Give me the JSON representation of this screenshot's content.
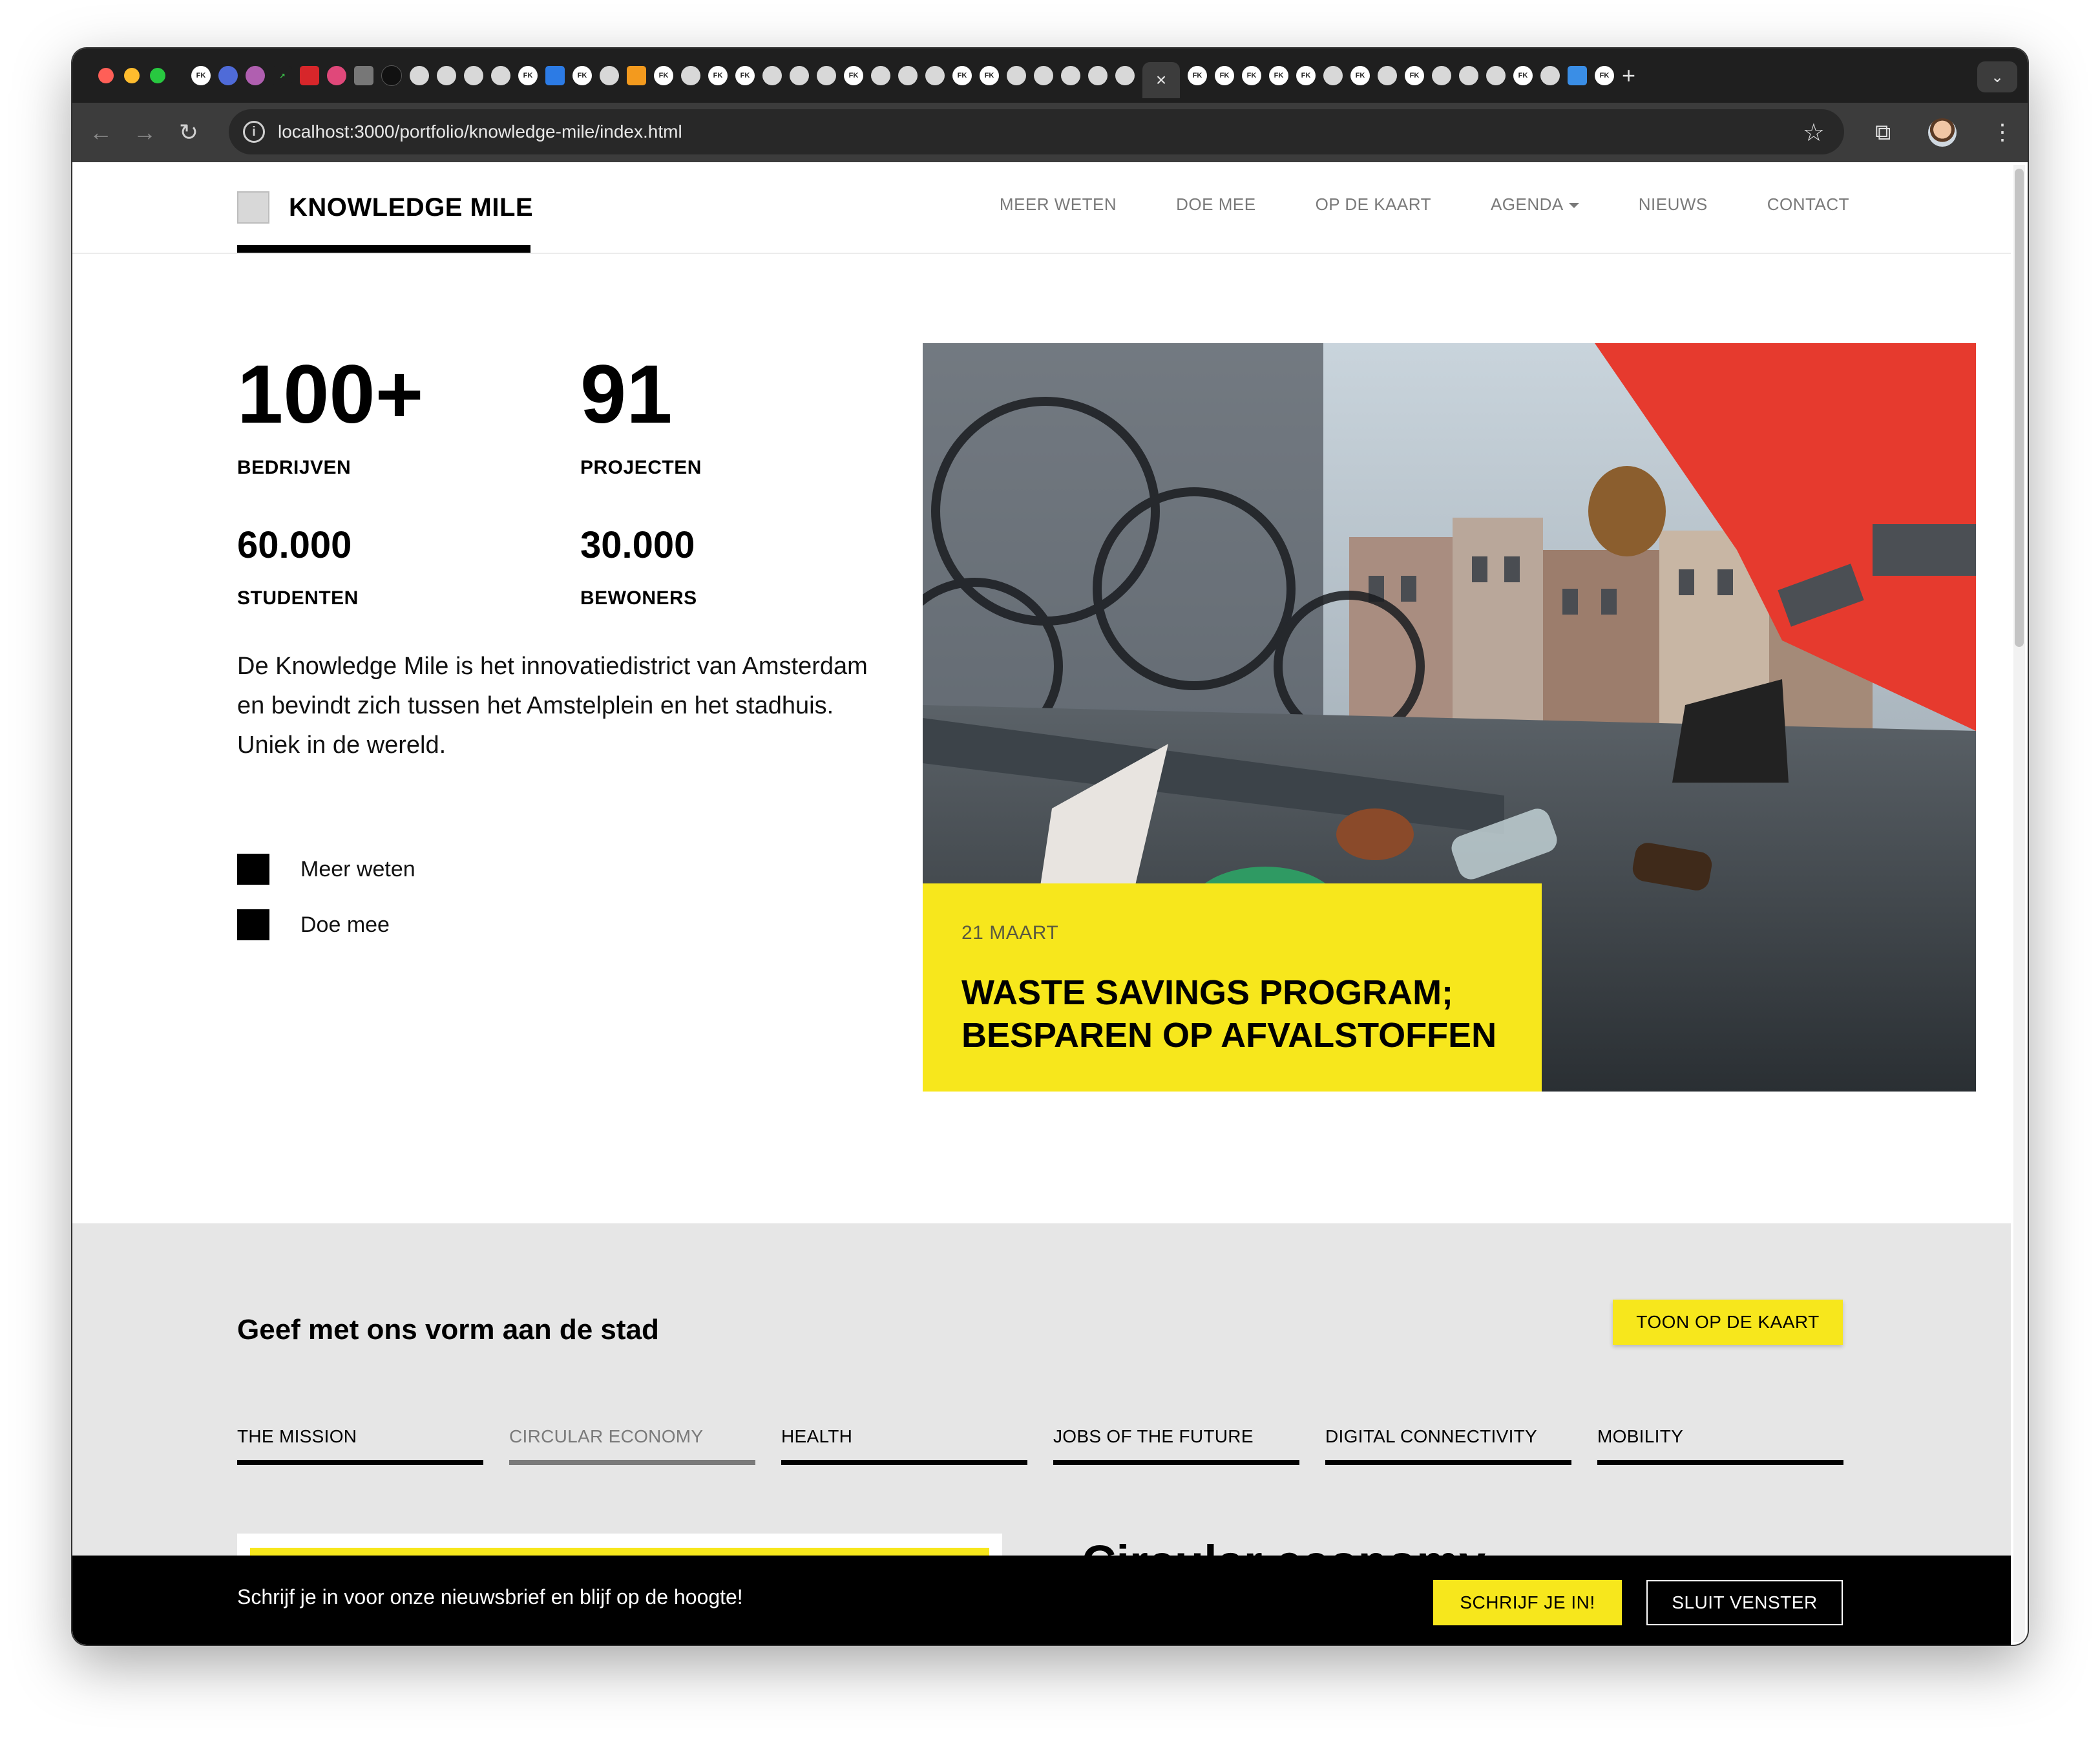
{
  "browser": {
    "url": "localhost:3000/portfolio/knowledge-mile/index.html",
    "active_tab_close": "×",
    "new_tab": "+",
    "favicon_text": "FK"
  },
  "site": {
    "logo_text": "KNOWLEDGE MILE",
    "nav": [
      "MEER WETEN",
      "DOE MEE",
      "OP DE KAART",
      "AGENDA",
      "NIEUWS",
      "CONTACT"
    ]
  },
  "stats": {
    "companies": {
      "value": "100+",
      "label": "BEDRIJVEN"
    },
    "projects": {
      "value": "91",
      "label": "PROJECTEN"
    },
    "students": {
      "value": "60.000",
      "label": "STUDENTEN"
    },
    "residents": {
      "value": "30.000",
      "label": "BEWONERS"
    }
  },
  "intro": "De Knowledge Mile is het innovatiedistrict van Amsterdam en bevindt zich tussen het Amstelplein en het stadhuis. Uniek in de wereld.",
  "ctas": [
    "Meer weten",
    "Doe mee"
  ],
  "hero": {
    "date": "21 MAART",
    "title": "WASTE SAVINGS PROGRAM; BESPAREN OP AFVALSTOFFEN"
  },
  "section": {
    "title": "Geef met ons vorm aan de stad",
    "map_button": "TOON OP DE KAART",
    "themes": [
      "THE MISSION",
      "CIRCULAR ECONOMY",
      "HEALTH",
      "JOBS OF THE FUTURE",
      "DIGITAL CONNECTIVITY",
      "MOBILITY"
    ],
    "active_theme": "CIRCULAR ECONOMY",
    "sub_heading": "Circular economy"
  },
  "newsletter": {
    "text": "Schrijf je in voor onze nieuwsbrief en blijf op de hoogte!",
    "subscribe": "SCHRIJF JE IN!",
    "close": "SLUIT VENSTER"
  },
  "colors": {
    "accent": "#f7e71c",
    "dark": "#000000",
    "grey_section": "#e6e6e6"
  }
}
